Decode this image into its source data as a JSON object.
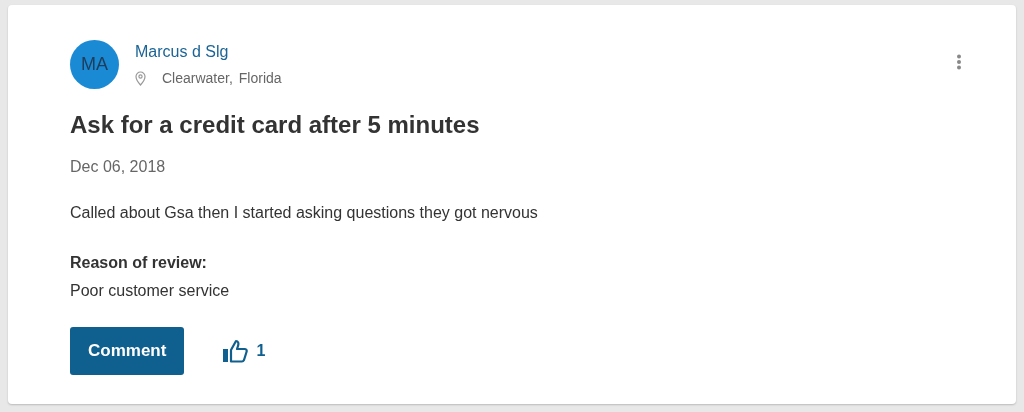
{
  "review": {
    "avatar_initials": "MA",
    "author": "Marcus d Slg",
    "city": "Clearwater,",
    "state": "Florida",
    "title": "Ask for a credit card after 5 minutes",
    "date": "Dec 06, 2018",
    "body": "Called about Gsa then I started asking questions they got nervous",
    "reason_label": "Reason of review:",
    "reason": "Poor customer service",
    "comment_button": "Comment",
    "likes": "1"
  }
}
